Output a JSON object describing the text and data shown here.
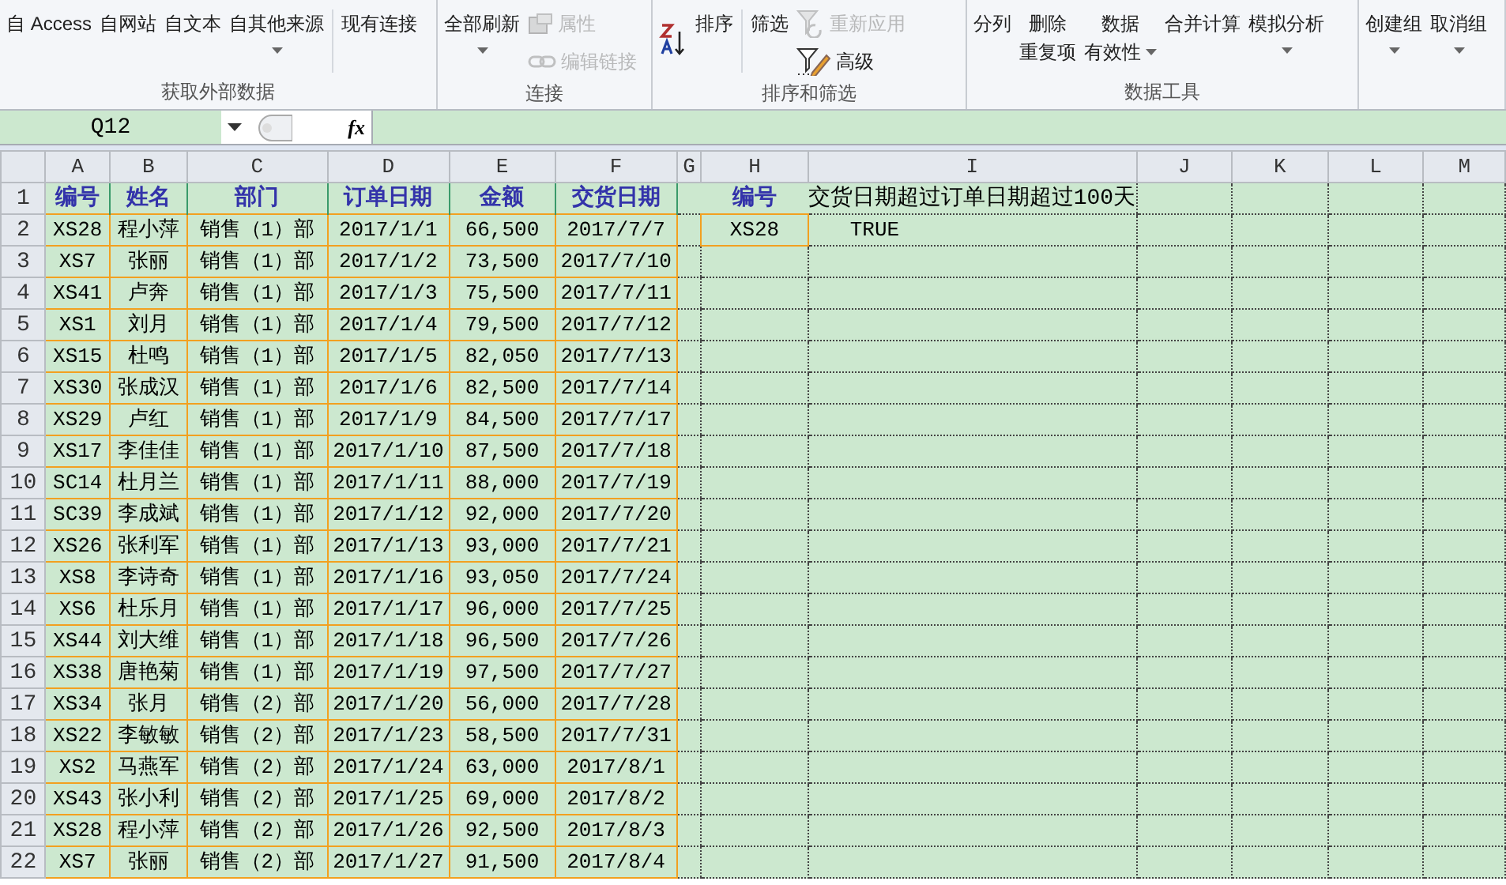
{
  "ribbon": {
    "groups": [
      {
        "title": "获取外部数据",
        "items": [
          {
            "kind": "large",
            "label": "自 Access"
          },
          {
            "kind": "large",
            "label": "自网站"
          },
          {
            "kind": "large",
            "label": "自文本"
          },
          {
            "kind": "large",
            "label": "自其他来源",
            "dropdown": true
          },
          {
            "kind": "separator"
          },
          {
            "kind": "large",
            "label": "现有连接"
          }
        ]
      },
      {
        "title": "连接",
        "items": [
          {
            "kind": "large",
            "label": "全部刷新",
            "dropdown": true
          },
          {
            "kind": "stack",
            "buttons": [
              {
                "label": "属性",
                "disabled": true
              },
              {
                "label": "编辑链接",
                "disabled": true
              }
            ]
          }
        ]
      },
      {
        "title": "排序和筛选",
        "items": [
          {
            "kind": "stack",
            "buttons": [
              {
                "disabled": false
              }
            ]
          },
          {
            "kind": "large",
            "label": "排序"
          },
          {
            "kind": "separator"
          },
          {
            "kind": "large",
            "label": "筛选"
          },
          {
            "kind": "stack",
            "buttons": [
              {
                "label": "重新应用",
                "disabled": true
              },
              {
                "label": "高级",
                "disabled": false
              }
            ]
          }
        ]
      },
      {
        "title": "数据工具",
        "items": [
          {
            "kind": "large",
            "label": "分列"
          },
          {
            "kind": "large",
            "label": "删除",
            "label2": "重复项"
          },
          {
            "kind": "large",
            "label": "数据",
            "label2": "有效性",
            "dropdown": true
          },
          {
            "kind": "large",
            "label": "合并计算"
          },
          {
            "kind": "large",
            "label": "模拟分析",
            "dropdown": true
          }
        ]
      },
      {
        "items": [
          {
            "kind": "large",
            "label": "创建组",
            "dropdown": true
          },
          {
            "kind": "large",
            "label": "取消组",
            "dropdown": true
          }
        ]
      }
    ]
  },
  "formula_bar": {
    "name_box": "Q12",
    "function_label": "fx"
  },
  "sheet": {
    "columns": [
      "A",
      "B",
      "C",
      "D",
      "E",
      "F",
      "G",
      "H",
      "I",
      "J",
      "K",
      "L",
      "M"
    ],
    "row_numbers": [
      "1",
      "2",
      "3",
      "4",
      "5",
      "6",
      "7",
      "8",
      "9",
      "10",
      "11",
      "12",
      "13",
      "14",
      "15",
      "16",
      "17",
      "18",
      "19",
      "20",
      "21",
      "22"
    ],
    "table": {
      "header": [
        "编号",
        "姓名",
        "部门",
        "订单日期",
        "金额",
        "交货日期"
      ],
      "rows": [
        [
          "XS28",
          "程小萍",
          "销售（1）部",
          "2017/1/1",
          "66,500",
          "2017/7/7"
        ],
        [
          "XS7",
          "张丽",
          "销售（1）部",
          "2017/1/2",
          "73,500",
          "2017/7/10"
        ],
        [
          "XS41",
          "卢奔",
          "销售（1）部",
          "2017/1/3",
          "75,500",
          "2017/7/11"
        ],
        [
          "XS1",
          "刘月",
          "销售（1）部",
          "2017/1/4",
          "79,500",
          "2017/7/12"
        ],
        [
          "XS15",
          "杜鸣",
          "销售（1）部",
          "2017/1/5",
          "82,050",
          "2017/7/13"
        ],
        [
          "XS30",
          "张成汉",
          "销售（1）部",
          "2017/1/6",
          "82,500",
          "2017/7/14"
        ],
        [
          "XS29",
          "卢红",
          "销售（1）部",
          "2017/1/9",
          "84,500",
          "2017/7/17"
        ],
        [
          "XS17",
          "李佳佳",
          "销售（1）部",
          "2017/1/10",
          "87,500",
          "2017/7/18"
        ],
        [
          "SC14",
          "杜月兰",
          "销售（1）部",
          "2017/1/11",
          "88,000",
          "2017/7/19"
        ],
        [
          "SC39",
          "李成斌",
          "销售（1）部",
          "2017/1/12",
          "92,000",
          "2017/7/20"
        ],
        [
          "XS26",
          "张利军",
          "销售（1）部",
          "2017/1/13",
          "93,000",
          "2017/7/21"
        ],
        [
          "XS8",
          "李诗奇",
          "销售（1）部",
          "2017/1/16",
          "93,050",
          "2017/7/24"
        ],
        [
          "XS6",
          "杜乐月",
          "销售（1）部",
          "2017/1/17",
          "96,000",
          "2017/7/25"
        ],
        [
          "XS44",
          "刘大维",
          "销售（1）部",
          "2017/1/18",
          "96,500",
          "2017/7/26"
        ],
        [
          "XS38",
          "唐艳菊",
          "销售（1）部",
          "2017/1/19",
          "97,500",
          "2017/7/27"
        ],
        [
          "XS34",
          "张月",
          "销售（2）部",
          "2017/1/20",
          "56,000",
          "2017/7/28"
        ],
        [
          "XS22",
          "李敏敏",
          "销售（2）部",
          "2017/1/23",
          "58,500",
          "2017/7/31"
        ],
        [
          "XS2",
          "马燕军",
          "销售（2）部",
          "2017/1/24",
          "63,000",
          "2017/8/1"
        ],
        [
          "XS43",
          "张小利",
          "销售（2）部",
          "2017/1/25",
          "69,000",
          "2017/8/2"
        ],
        [
          "XS28",
          "程小萍",
          "销售（2）部",
          "2017/1/26",
          "92,500",
          "2017/8/3"
        ],
        [
          "XS7",
          "张丽",
          "销售（2）部",
          "2017/1/27",
          "91,500",
          "2017/8/4"
        ]
      ]
    },
    "lookup": {
      "header": "编号",
      "rows": [
        {
          "id": "XS28",
          "result": "TRUE"
        }
      ],
      "title": "交货日期超过订单日期超过100天"
    }
  }
}
